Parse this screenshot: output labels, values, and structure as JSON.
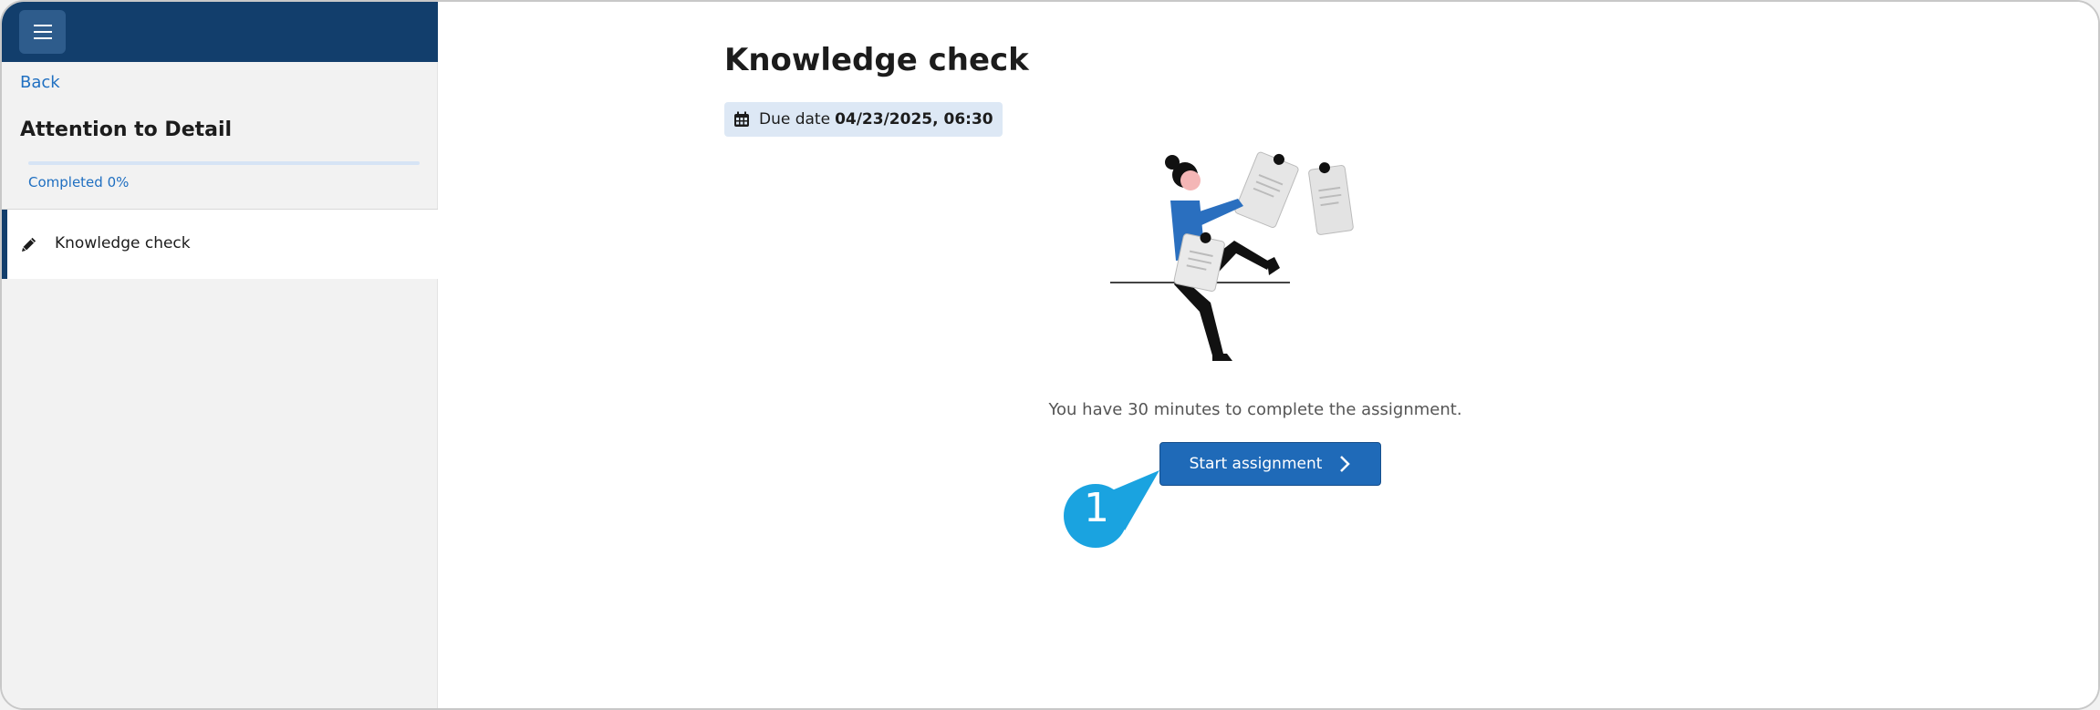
{
  "sidebar": {
    "menu_icon": "hamburger-menu-icon",
    "back_label": "Back",
    "course_title": "Attention to Detail",
    "progress_label": "Completed 0%",
    "progress_value": 0,
    "items": [
      {
        "label": "Knowledge check",
        "icon": "pencil-icon"
      }
    ]
  },
  "main": {
    "title": "Knowledge check",
    "due_label": "Due date",
    "due_value": "04/23/2025, 06:30",
    "info_text": "You have 30 minutes to complete the assignment.",
    "start_button_label": "Start assignment"
  },
  "callout": {
    "number": "1"
  },
  "colors": {
    "header_bg": "#123e6c",
    "accent": "#1f6fc1",
    "button_bg": "#1f6ab8",
    "callout": "#1aa3e0",
    "illustration_blue": "#2a6fbf"
  }
}
